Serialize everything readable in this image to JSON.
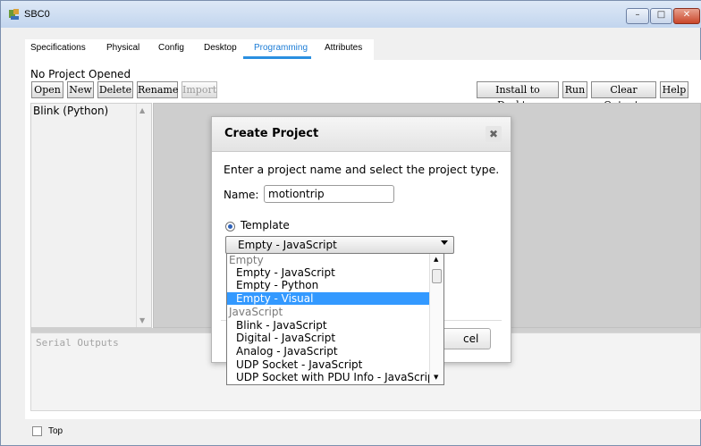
{
  "window": {
    "title": "SBC0"
  },
  "tabs": [
    "Specifications",
    "Physical",
    "Config",
    "Desktop",
    "Programming",
    "Attributes"
  ],
  "status": "No Project Opened",
  "toolbar_left": [
    "Open",
    "New",
    "Delete",
    "Rename",
    "Import"
  ],
  "toolbar_right": [
    "Install to Desktop",
    "Run",
    "Clear Outputs",
    "Help"
  ],
  "project_list": [
    "Blink (Python)"
  ],
  "serial": {
    "placeholder": "Serial Outputs"
  },
  "top_checkbox": {
    "label": "Top"
  },
  "dialog": {
    "title": "Create Project",
    "prompt": "Enter a project name and select the project type.",
    "name_label": "Name:",
    "name_value": "motiontrip",
    "template_label": "Template",
    "selected": "Empty - JavaScript",
    "cancel_label": "Cancel",
    "cancel_visible": "cel"
  },
  "dropdown": [
    {
      "text": "Empty",
      "kind": "group"
    },
    {
      "text": "Empty - JavaScript",
      "kind": "opt"
    },
    {
      "text": "Empty - Python",
      "kind": "opt"
    },
    {
      "text": "Empty - Visual",
      "kind": "sel"
    },
    {
      "text": "JavaScript",
      "kind": "group"
    },
    {
      "text": "Blink - JavaScript",
      "kind": "opt"
    },
    {
      "text": "Digital - JavaScript",
      "kind": "opt"
    },
    {
      "text": "Analog - JavaScript",
      "kind": "opt"
    },
    {
      "text": "UDP Socket - JavaScript",
      "kind": "opt"
    },
    {
      "text": "UDP Socket with PDU Info - JavaScript",
      "kind": "opt"
    }
  ]
}
